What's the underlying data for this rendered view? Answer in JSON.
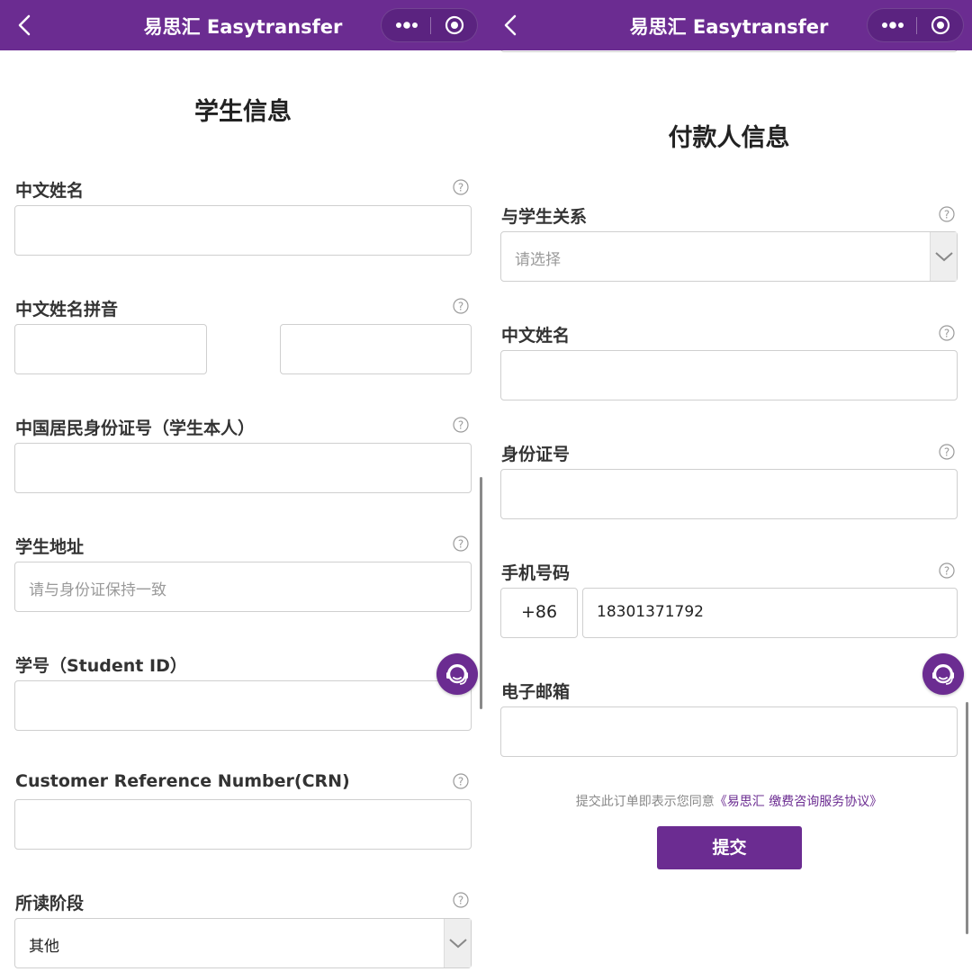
{
  "app": {
    "title": "易思汇 Easytransfer"
  },
  "colors": {
    "brand": "#6b2c91",
    "border": "#cfcfcf",
    "placeholder": "#9a9a9a"
  },
  "icons": {
    "back": "back-arrow-icon",
    "more": "more-dots-icon",
    "close": "target-close-icon",
    "help": "question-circle-icon",
    "service": "customer-service-icon",
    "dropdown": "chevron-down-icon"
  },
  "student": {
    "title": "学生信息",
    "cn_name": {
      "label": "中文姓名",
      "value": ""
    },
    "pinyin": {
      "label": "中文姓名拼音",
      "surname": "",
      "given_name": ""
    },
    "id_card": {
      "label": "中国居民身份证号（学生本人）",
      "value": ""
    },
    "address": {
      "label": "学生地址",
      "placeholder": "请与身份证保持一致"
    },
    "student_id": {
      "label": "学号（Student ID）",
      "value": ""
    },
    "crn": {
      "label": "Customer Reference Number(CRN)",
      "value": ""
    },
    "stage": {
      "label": "所读阶段",
      "selected": "其他"
    }
  },
  "payer": {
    "title": "付款人信息",
    "relationship": {
      "label": "与学生关系",
      "placeholder": "请选择"
    },
    "cn_name": {
      "label": "中文姓名",
      "value": ""
    },
    "id_number": {
      "label": "身份证号",
      "value": ""
    },
    "phone": {
      "label": "手机号码",
      "country_code": "+86",
      "value": "18301371792"
    },
    "email": {
      "label": "电子邮箱",
      "value": ""
    },
    "agreement_prefix": "提交此订单即表示您同意",
    "agreement_link": "《易思汇 缴费咨询服务协议》",
    "submit_label": "提交"
  }
}
